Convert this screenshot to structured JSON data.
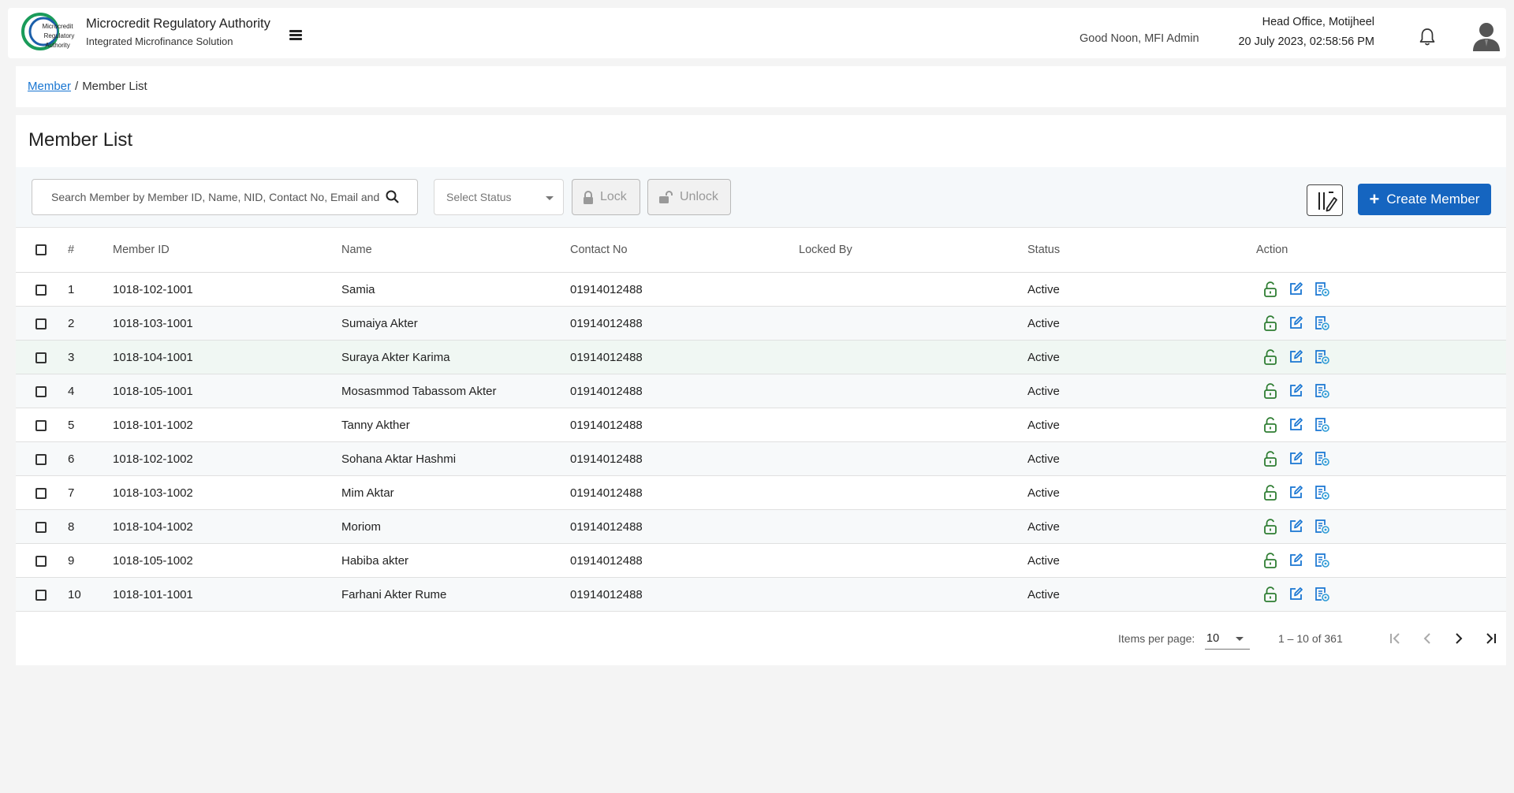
{
  "header": {
    "logo_lines": [
      "Microcredit",
      "Regulatory",
      "Authority"
    ],
    "title": "Microcredit Regulatory Authority",
    "subtitle": "Integrated Microfinance Solution",
    "greeting": "Good Noon, MFI Admin",
    "office": "Head Office, Motijheel",
    "datetime": "20 July 2023, 02:58:56 PM"
  },
  "breadcrumb": {
    "parent": "Member",
    "separator": "/",
    "current": "Member List"
  },
  "page": {
    "title": "Member List"
  },
  "toolbar": {
    "search_placeholder": "Search Member by Member ID, Name, NID, Contact No, Email and Status",
    "status_placeholder": "Select Status",
    "lock_label": "Lock",
    "unlock_label": "Unlock",
    "create_label": "Create Member",
    "create_icon": "+"
  },
  "table": {
    "columns": [
      "#",
      "Member ID",
      "Name",
      "Contact No",
      "Locked By",
      "Status",
      "Action"
    ],
    "rows": [
      {
        "num": "1",
        "member_id": "1018-102-1001",
        "name": "Samia",
        "contact": "01914012488",
        "locked_by": "",
        "status": "Active"
      },
      {
        "num": "2",
        "member_id": "1018-103-1001",
        "name": "Sumaiya Akter",
        "contact": "01914012488",
        "locked_by": "",
        "status": "Active"
      },
      {
        "num": "3",
        "member_id": "1018-104-1001",
        "name": "Suraya Akter Karima",
        "contact": "01914012488",
        "locked_by": "",
        "status": "Active"
      },
      {
        "num": "4",
        "member_id": "1018-105-1001",
        "name": "Mosasmmod Tabassom Akter",
        "contact": "01914012488",
        "locked_by": "",
        "status": "Active"
      },
      {
        "num": "5",
        "member_id": "1018-101-1002",
        "name": "Tanny Akther",
        "contact": "01914012488",
        "locked_by": "",
        "status": "Active"
      },
      {
        "num": "6",
        "member_id": "1018-102-1002",
        "name": "Sohana Aktar Hashmi",
        "contact": "01914012488",
        "locked_by": "",
        "status": "Active"
      },
      {
        "num": "7",
        "member_id": "1018-103-1002",
        "name": "Mim Aktar",
        "contact": "01914012488",
        "locked_by": "",
        "status": "Active"
      },
      {
        "num": "8",
        "member_id": "1018-104-1002",
        "name": "Moriom",
        "contact": "01914012488",
        "locked_by": "",
        "status": "Active"
      },
      {
        "num": "9",
        "member_id": "1018-105-1002",
        "name": "Habiba akter",
        "contact": "01914012488",
        "locked_by": "",
        "status": "Active"
      },
      {
        "num": "10",
        "member_id": "1018-101-1001",
        "name": "Farhani Akter Rume",
        "contact": "01914012488",
        "locked_by": "",
        "status": "Active"
      }
    ],
    "action_icons": [
      "unlock-icon",
      "edit-icon",
      "document-view-icon"
    ]
  },
  "paginator": {
    "items_per_page_label": "Items per page:",
    "items_per_page": "10",
    "range_label": "1 – 10 of 361"
  },
  "colors": {
    "primary": "#1565c0",
    "link": "#1976d2",
    "unlock_icon": "#2e7d32",
    "edit_icon": "#1976d2",
    "logo_green": "#1a9b5a"
  }
}
